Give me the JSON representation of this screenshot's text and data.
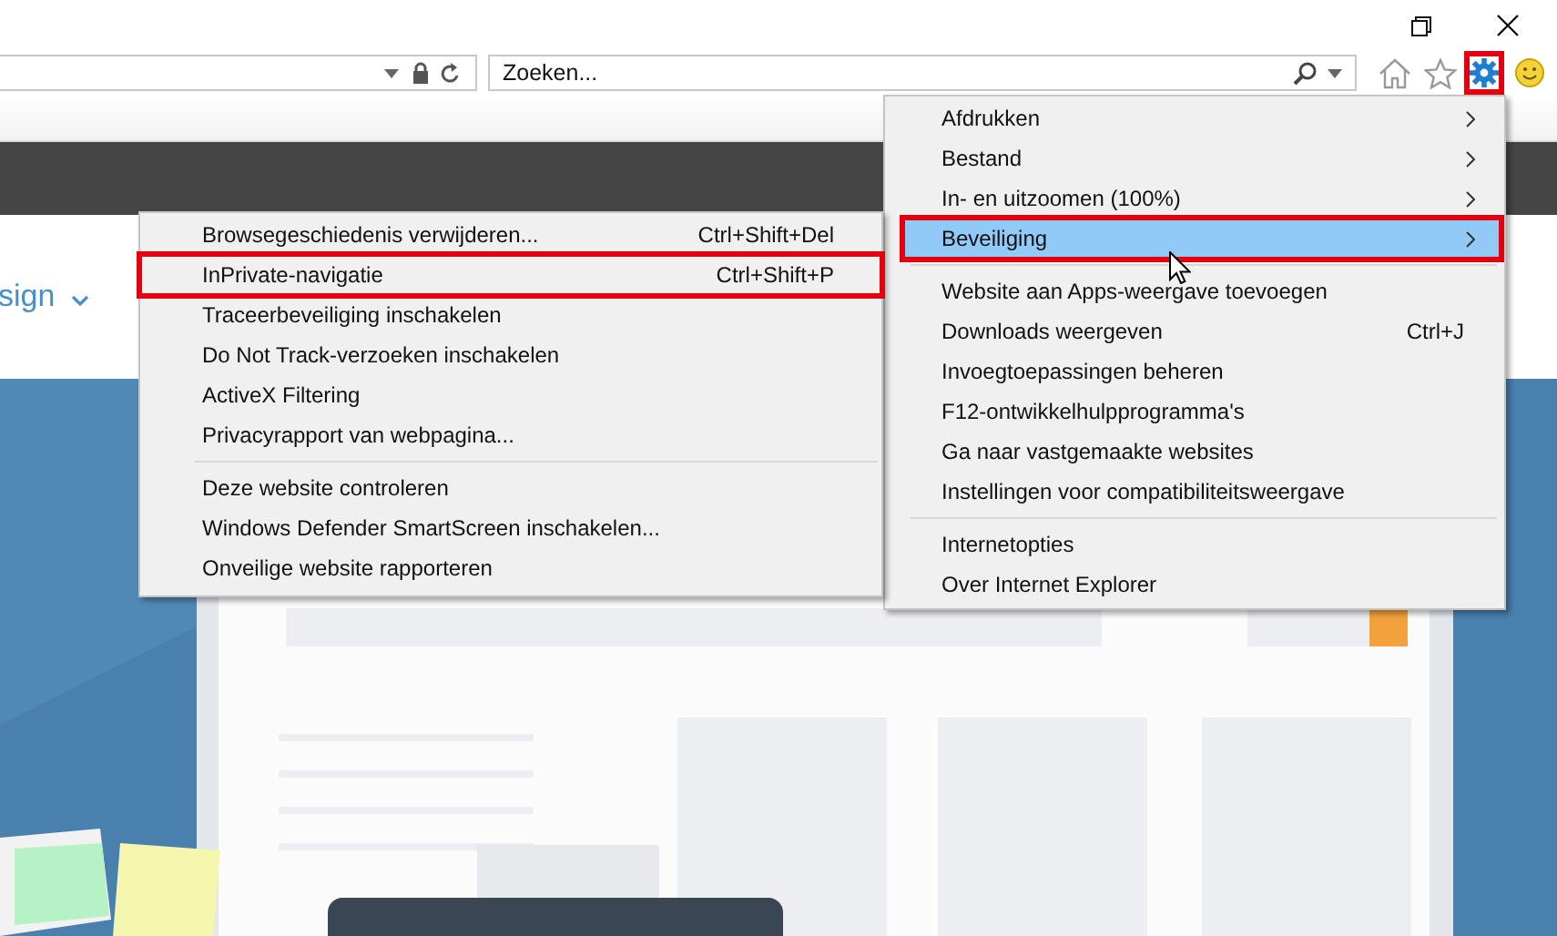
{
  "search": {
    "placeholder": "Zoeken..."
  },
  "toolbar": {
    "settings_annotated": true
  },
  "page": {
    "nav_link": "sign"
  },
  "tools_menu": {
    "items": [
      {
        "kind": "item",
        "label": "Afdrukken",
        "submenu": true,
        "selected": false,
        "annotated": false
      },
      {
        "kind": "item",
        "label": "Bestand",
        "submenu": true,
        "selected": false,
        "annotated": false
      },
      {
        "kind": "item",
        "label": "In- en uitzoomen (100%)",
        "submenu": true,
        "selected": false,
        "annotated": false
      },
      {
        "kind": "item",
        "label": "Beveiliging",
        "submenu": true,
        "selected": true,
        "annotated": true
      },
      {
        "kind": "separator"
      },
      {
        "kind": "item",
        "label": "Website aan Apps-weergave toevoegen",
        "submenu": false,
        "selected": false,
        "annotated": false
      },
      {
        "kind": "item",
        "label": "Downloads weergeven",
        "shortcut": "Ctrl+J",
        "submenu": false,
        "selected": false,
        "annotated": false
      },
      {
        "kind": "item",
        "label": "Invoegtoepassingen beheren",
        "submenu": false,
        "selected": false,
        "annotated": false
      },
      {
        "kind": "item",
        "label": "F12-ontwikkelhulpprogramma's",
        "submenu": false,
        "selected": false,
        "annotated": false
      },
      {
        "kind": "item",
        "label": "Ga naar vastgemaakte websites",
        "submenu": false,
        "selected": false,
        "annotated": false
      },
      {
        "kind": "item",
        "label": "Instellingen voor compatibiliteitsweergave",
        "submenu": false,
        "selected": false,
        "annotated": false
      },
      {
        "kind": "separator"
      },
      {
        "kind": "item",
        "label": "Internetopties",
        "submenu": false,
        "selected": false,
        "annotated": false
      },
      {
        "kind": "item",
        "label": "Over Internet Explorer",
        "submenu": false,
        "selected": false,
        "annotated": false
      }
    ]
  },
  "security_submenu": {
    "items": [
      {
        "kind": "item",
        "label": "Browsegeschiedenis verwijderen...",
        "shortcut": "Ctrl+Shift+Del",
        "selected": false,
        "annotated": false
      },
      {
        "kind": "item",
        "label": "InPrivate-navigatie",
        "shortcut": "Ctrl+Shift+P",
        "selected": false,
        "annotated": true
      },
      {
        "kind": "item",
        "label": "Traceerbeveiliging inschakelen",
        "selected": false,
        "annotated": false
      },
      {
        "kind": "item",
        "label": "Do Not Track-verzoeken inschakelen",
        "selected": false,
        "annotated": false
      },
      {
        "kind": "item",
        "label": "ActiveX Filtering",
        "selected": false,
        "annotated": false
      },
      {
        "kind": "item",
        "label": "Privacyrapport van webpagina...",
        "selected": false,
        "annotated": false
      },
      {
        "kind": "separator"
      },
      {
        "kind": "item",
        "label": "Deze website controleren",
        "selected": false,
        "annotated": false
      },
      {
        "kind": "item",
        "label": "Windows Defender SmartScreen inschakelen...",
        "selected": false,
        "annotated": false
      },
      {
        "kind": "item",
        "label": "Onveilige website rapporteren",
        "selected": false,
        "annotated": false
      }
    ]
  }
}
